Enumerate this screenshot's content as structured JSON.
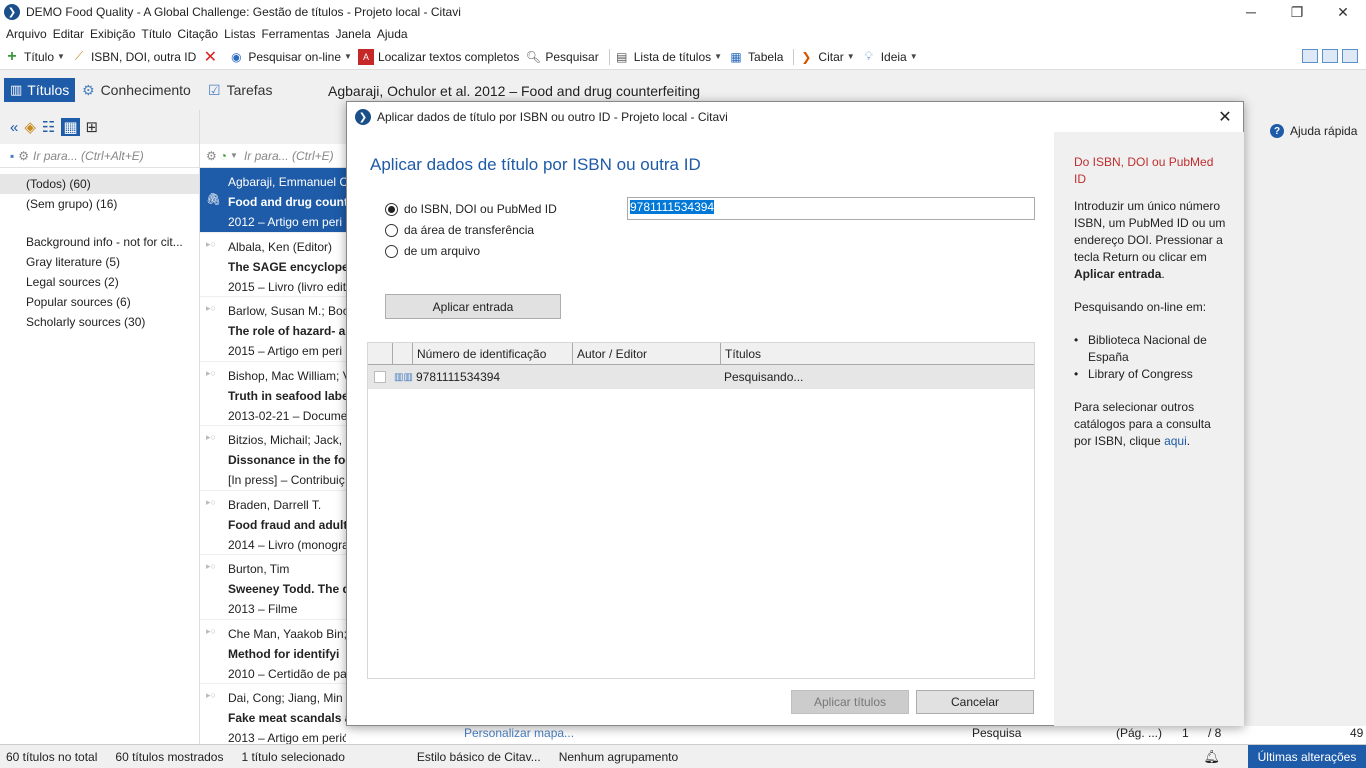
{
  "window": {
    "title": "DEMO Food Quality - A Global Challenge: Gestão de títulos - Projeto local - Citavi"
  },
  "menu": [
    "Arquivo",
    "Editar",
    "Exibição",
    "Título",
    "Citação",
    "Listas",
    "Ferramentas",
    "Janela",
    "Ajuda"
  ],
  "toolbar": {
    "title_label": "Título",
    "isbn_label": "ISBN, DOI, outra ID",
    "search_online_label": "Pesquisar on-line",
    "find_fulltext_label": "Localizar textos completos",
    "search_label": "Pesquisar",
    "title_list_label": "Lista de títulos",
    "table_label": "Tabela",
    "cite_label": "Citar",
    "idea_label": "Ideia"
  },
  "nav": {
    "tabs": [
      {
        "label": "Títulos",
        "active": true
      },
      {
        "label": "Conhecimento",
        "active": false
      },
      {
        "label": "Tarefas",
        "active": false
      }
    ],
    "current_title": "Agbaraji, Ochulor et al. 2012 – Food and drug counterfeiting",
    "help": "Ajuda rápida"
  },
  "left_panel": {
    "search_placeholder": "Ir para... (Ctrl+Alt+E)",
    "groups": [
      {
        "label": "(Todos) (60)",
        "selected": true
      },
      {
        "label": "(Sem grupo) (16)",
        "selected": false
      }
    ],
    "categories": [
      "Background info - not for cit...",
      "Gray literature (5)",
      "Legal sources (2)",
      "Popular sources (6)",
      "Scholarly sources (30)"
    ]
  },
  "middle_panel": {
    "search_placeholder": "Ir para... (Ctrl+E)",
    "entries": [
      {
        "author": "Agbaraji, Emmanuel C",
        "title": "Food and drug count",
        "meta": "2012 – Artigo em peri",
        "selected": true
      },
      {
        "author": "Albala, Ken (Editor)",
        "title": "The SAGE encyclope",
        "meta": "2015 – Livro (livro edit",
        "selected": false
      },
      {
        "author": "Barlow, Susan M.; Boo",
        "title": "The role of hazard- a",
        "meta": "2015 – Artigo em peri",
        "selected": false
      },
      {
        "author": "Bishop, Mac William; V",
        "title": "Truth in seafood labe",
        "meta": "2013-02-21 – Docume",
        "selected": false
      },
      {
        "author": "Bitzios, Michail; Jack, L",
        "title": "Dissonance in the foc",
        "meta": "[In press] – Contribuiç",
        "selected": false
      },
      {
        "author": "Braden, Darrell T.",
        "title": "Food fraud and adult",
        "meta": "2014 – Livro (monogra",
        "selected": false
      },
      {
        "author": "Burton, Tim",
        "title": "Sweeney Todd. The d",
        "meta": "2013 – Filme",
        "selected": false
      },
      {
        "author": "Che Man, Yaakob Bin;",
        "title": "Method for identifyi",
        "meta": "2010 – Certidão de pa",
        "selected": false
      },
      {
        "author": "Dai, Cong; Jiang, Min",
        "title": "Fake meat scandals a",
        "meta": "2013 – Artigo em periódico",
        "selected": false
      }
    ]
  },
  "dialog": {
    "window_title": "Aplicar dados de título por ISBN ou outro ID - Projeto local - Citavi",
    "heading": "Aplicar dados de título por ISBN ou outra ID",
    "options": [
      {
        "label": "do ISBN, DOI ou PubMed ID",
        "checked": true
      },
      {
        "label": "da área de transferência",
        "checked": false
      },
      {
        "label": "de um arquivo",
        "checked": false
      }
    ],
    "id_value": "9781111534394",
    "apply_entry_label": "Aplicar entrada",
    "columns": [
      "Número de identificação",
      "Autor / Editor",
      "Títulos"
    ],
    "rows": [
      {
        "id": "9781111534394",
        "author": "",
        "title": "Pesquisando..."
      }
    ],
    "apply_titles_label": "Aplicar títulos",
    "cancel_label": "Cancelar",
    "side": {
      "heading": "Do ISBN, DOI ou PubMed ID",
      "intro": "Introduzir um único número ISBN, um PubMed ID ou um endereço DOI. Pressionar a tecla Return ou clicar em",
      "intro_bold": "Aplicar entrada",
      "intro_end": ".",
      "search_label": "Pesquisando on-line em:",
      "catalogs": [
        "Biblioteca Nacional de España",
        "Library of Congress"
      ],
      "other_text": "Para selecionar outros catálogos para a consulta por ISBN, clique",
      "other_link": "aqui",
      "other_end": "."
    }
  },
  "bottom_strip": {
    "map_label": "Personalizar mapa...",
    "search_label": "Pesquisa",
    "page_label": "(Pág. ...)",
    "page_num": "1",
    "page_total": "/ 8",
    "zoom": "49"
  },
  "status": {
    "total": "60 títulos no total",
    "shown": "60 títulos mostrados",
    "selected": "1 título selecionado",
    "style": "Estilo básico de Citav...",
    "grouping": "Nenhum agrupamento",
    "recent": "Últimas alterações"
  }
}
